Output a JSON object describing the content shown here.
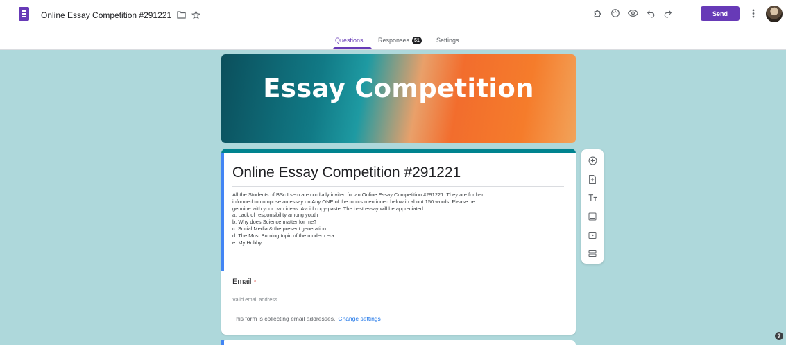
{
  "header": {
    "app_icon": "google-forms-icon",
    "title": "Online Essay Competition #291221",
    "icons": [
      "folder-icon",
      "star-icon",
      "addon-puzzle-icon",
      "palette-icon",
      "preview-eye-icon",
      "undo-icon",
      "redo-icon",
      "more-vert-icon"
    ],
    "send_label": "Send",
    "accent_color": "#673ab7"
  },
  "tabs": {
    "questions": "Questions",
    "responses": "Responses",
    "responses_count": "51",
    "settings": "Settings",
    "active": "Questions"
  },
  "banner": {
    "title": "Essay Competition"
  },
  "form": {
    "title": "Online Essay Competition #291221",
    "description_lines": [
      "All the Students of BSc I sem are cordially invited for an Online Essay Competition #291221. They are further",
      "informed to compose an essay on Any ONE of the topics mentioned below in about 150 words. Please be",
      "genuine with your own ideas. Avoid copy-paste. The best essay will be appreciated.",
      "a. Lack of responsibility among youth",
      "b. Why does Science matter for me?",
      "c. Social Media & the present generation",
      "d. The Most Burning topic of the modern era",
      "e. My Hobby"
    ],
    "email_label": "Email",
    "required_mark": "*",
    "email_placeholder": "Valid email address",
    "collect_note": "This form is collecting email addresses.",
    "change_settings_link": "Change settings"
  },
  "toolbar": {
    "icons": [
      "add-question-icon",
      "import-questions-icon",
      "add-title-icon",
      "add-image-icon",
      "add-video-icon",
      "add-section-icon"
    ]
  },
  "colors": {
    "background": "#aed8db",
    "header_accent": "#00838f",
    "link": "#1a73e8"
  }
}
